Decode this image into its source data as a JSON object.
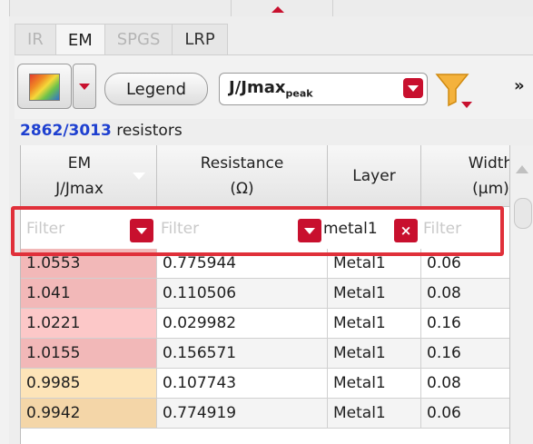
{
  "tabs": [
    {
      "label": "IR",
      "active": false
    },
    {
      "label": "EM",
      "active": true
    },
    {
      "label": "SPGS",
      "active": false
    },
    {
      "label": "LRP",
      "active": false
    }
  ],
  "toolbar": {
    "legend_label": "Legend",
    "select_value": "J/Jmax",
    "select_sub": "peak",
    "more_label": "»"
  },
  "count": {
    "shown": "2862/3013",
    "unit": " resistors"
  },
  "columns": [
    {
      "line1": "EM",
      "line2": "J/Jmax"
    },
    {
      "line1": "Resistance",
      "line2": "(Ω)"
    },
    {
      "line1": "Layer"
    },
    {
      "line1": "Width",
      "line2": "(µm)"
    }
  ],
  "filters": {
    "em_placeholder": "Filter",
    "resistance_placeholder": "Filter",
    "layer_value": "metal1",
    "width_placeholder": "Filter",
    "clear_label": "×"
  },
  "rows": [
    {
      "em": "1.0553",
      "resistance": "0.775944",
      "layer": "Metal1",
      "width": "0.06",
      "color": "#f2b8b8"
    },
    {
      "em": "1.041",
      "resistance": "0.110506",
      "layer": "Metal1",
      "width": "0.08",
      "color": "#f2b8b8"
    },
    {
      "em": "1.0221",
      "resistance": "0.029982",
      "layer": "Metal1",
      "width": "0.16",
      "color": "#fcc8c8"
    },
    {
      "em": "1.0155",
      "resistance": "0.156571",
      "layer": "Metal1",
      "width": "0.16",
      "color": "#f2b8b8"
    },
    {
      "em": "0.9985",
      "resistance": "0.107743",
      "layer": "Metal1",
      "width": "0.08",
      "color": "#fde4b8"
    },
    {
      "em": "0.9942",
      "resistance": "0.774919",
      "layer": "Metal1",
      "width": "0.06",
      "color": "#f4d6a8"
    }
  ],
  "colors": {
    "accent": "#c8102e",
    "link": "#1e40d0",
    "highlight": "#e0303a"
  }
}
